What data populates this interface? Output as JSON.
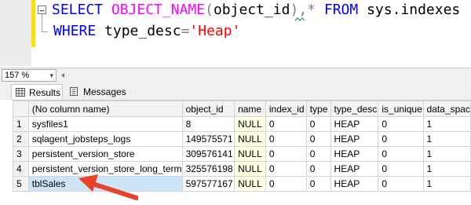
{
  "editor": {
    "line1": {
      "kw1": "SELECT",
      "fn": "OBJECT_NAME",
      "open": "(",
      "arg": "object_id",
      "close": "),",
      "star": "*",
      "kw2": "FROM",
      "table": "sys.indexes"
    },
    "line2": {
      "kw": "WHERE",
      "col": "type_desc",
      "eq": "=",
      "val": "'Heap'"
    },
    "collapse_symbol": "−"
  },
  "status": {
    "zoom": "157 %",
    "zoom_arrow": "▾"
  },
  "tabs": {
    "results": "Results",
    "messages": "Messages"
  },
  "grid": {
    "columns": [
      "",
      "(No column name)",
      "object_id",
      "name",
      "index_id",
      "type",
      "type_desc",
      "is_unique",
      "data_spac"
    ],
    "rows": [
      [
        "1",
        "sysfiles1",
        "8",
        "NULL",
        "0",
        "0",
        "HEAP",
        "0",
        "1"
      ],
      [
        "2",
        "sqlagent_jobsteps_logs",
        "149575571",
        "NULL",
        "0",
        "0",
        "HEAP",
        "0",
        "1"
      ],
      [
        "3",
        "persistent_version_store",
        "309576141",
        "NULL",
        "0",
        "0",
        "HEAP",
        "0",
        "1"
      ],
      [
        "4",
        "persistent_version_store_long_term",
        "325576198",
        "NULL",
        "0",
        "0",
        "HEAP",
        "0",
        "1"
      ],
      [
        "5",
        "tblSales",
        "597577167",
        "NULL",
        "0",
        "0",
        "HEAP",
        "0",
        "1"
      ]
    ],
    "selected_row": 5
  },
  "colors": {
    "keyword": "#0000ff",
    "function": "#ff00ff",
    "string": "#ff0000",
    "null_cell": "#ffffe1",
    "arrow": "#e8432a"
  }
}
